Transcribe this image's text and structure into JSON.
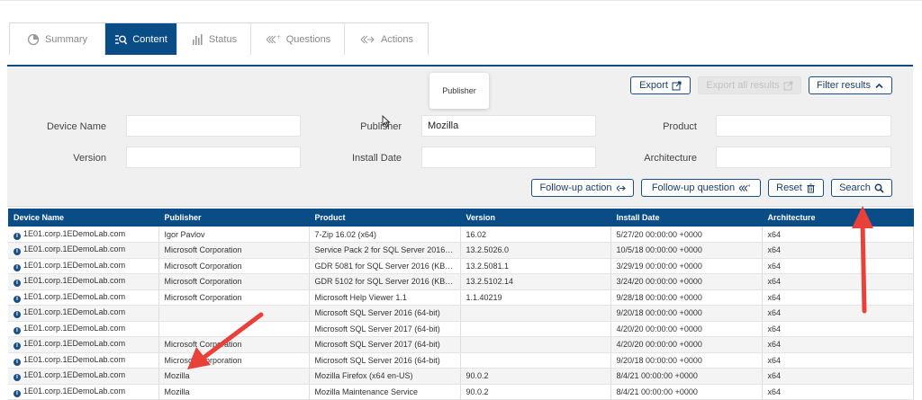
{
  "tabs": [
    {
      "label": "Summary",
      "icon": "pie-chart-icon"
    },
    {
      "label": "Content",
      "icon": "content-search-icon"
    },
    {
      "label": "Status",
      "icon": "bar-chart-icon"
    },
    {
      "label": "Questions",
      "icon": "questions-icon"
    },
    {
      "label": "Actions",
      "icon": "actions-icon"
    }
  ],
  "toolbar": {
    "export_label": "Export",
    "export_all_label": "Export all results",
    "filter_results_label": "Filter results"
  },
  "tooltip": "Publisher",
  "filters": {
    "device_name": {
      "label": "Device Name",
      "value": ""
    },
    "publisher": {
      "label": "Publisher",
      "value": "Mozilla"
    },
    "product": {
      "label": "Product",
      "value": ""
    },
    "version": {
      "label": "Version",
      "value": ""
    },
    "install_date": {
      "label": "Install Date",
      "value": ""
    },
    "architecture": {
      "label": "Architecture",
      "value": ""
    }
  },
  "actions": {
    "followup_action": "Follow-up action",
    "followup_question": "Follow-up question",
    "reset": "Reset",
    "search": "Search"
  },
  "table": {
    "columns": [
      "Device Name",
      "Publisher",
      "Product",
      "Version",
      "Install Date",
      "Architecture"
    ],
    "rows": [
      [
        "1E01.corp.1EDemoLab.com",
        "Igor Pavlov",
        "7-Zip 16.02 (x64)",
        "16.02",
        "5/27/20 00:00:00 +0000",
        "x64"
      ],
      [
        "1E01.corp.1EDemoLab.com",
        "Microsoft Corporation",
        "Service Pack 2 for SQL Server 2016 (...",
        "13.2.5026.0",
        "10/5/18 00:00:00 +0000",
        "x64"
      ],
      [
        "1E01.corp.1EDemoLab.com",
        "Microsoft Corporation",
        "GDR 5081 for SQL Server 2016 (KB42...",
        "13.2.5081.1",
        "3/29/19 00:00:00 +0000",
        "x64"
      ],
      [
        "1E01.corp.1EDemoLab.com",
        "Microsoft Corporation",
        "GDR 5102 for SQL Server 2016 (KB45...",
        "13.2.5102.14",
        "3/24/20 00:00:00 +0000",
        "x64"
      ],
      [
        "1E01.corp.1EDemoLab.com",
        "Microsoft Corporation",
        "Microsoft Help Viewer 1.1",
        "1.1.40219",
        "9/28/18 00:00:00 +0000",
        "x64"
      ],
      [
        "1E01.corp.1EDemoLab.com",
        "",
        "Microsoft SQL Server 2016 (64-bit)",
        "",
        "9/20/18 00:00:00 +0000",
        "x64"
      ],
      [
        "1E01.corp.1EDemoLab.com",
        "",
        "Microsoft SQL Server 2017 (64-bit)",
        "",
        "4/20/20 00:00:00 +0000",
        "x64"
      ],
      [
        "1E01.corp.1EDemoLab.com",
        "Microsoft Corporation",
        "Microsoft SQL Server 2017 (64-bit)",
        "",
        "4/20/20 00:00:00 +0000",
        "x64"
      ],
      [
        "1E01.corp.1EDemoLab.com",
        "Microsoft Corporation",
        "Microsoft SQL Server 2016 (64-bit)",
        "",
        "9/20/18 00:00:00 +0000",
        "x64"
      ],
      [
        "1E01.corp.1EDemoLab.com",
        "Mozilla",
        "Mozilla Firefox (x64 en-US)",
        "90.0.2",
        "8/4/21 00:00:00 +0000",
        "x64"
      ],
      [
        "1E01.corp.1EDemoLab.com",
        "Mozilla",
        "Mozilla Maintenance Service",
        "90.0.2",
        "8/4/21 00:00:00 +0000",
        "x64"
      ]
    ]
  },
  "colors": {
    "brand": "#0a4c85",
    "annotation_arrow": "#e8413a"
  }
}
